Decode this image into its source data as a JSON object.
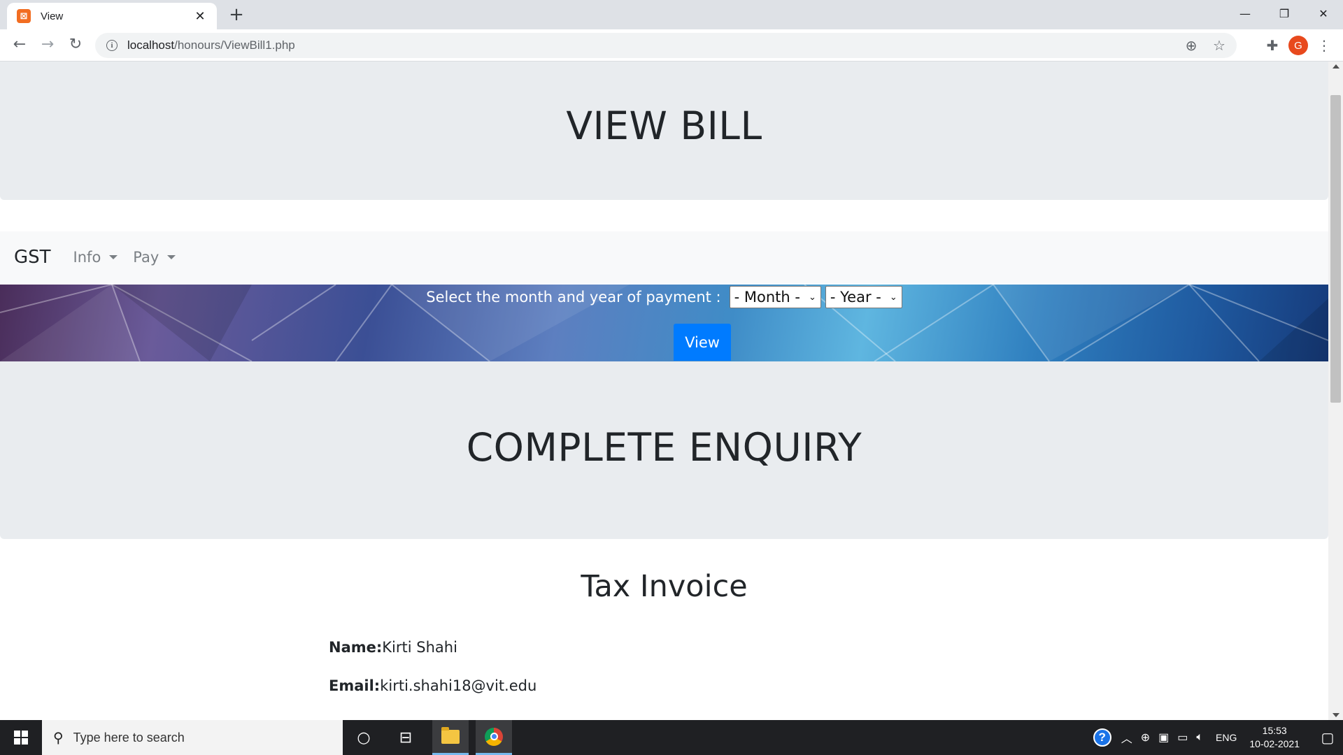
{
  "browser": {
    "tab_title": "View",
    "url_host": "localhost",
    "url_path": "/honours/ViewBill1.php",
    "profile_initial": "G",
    "icons": [
      "back-icon",
      "forward-icon",
      "reload-icon",
      "info-icon",
      "zoom-icon",
      "star-icon",
      "extensions-icon",
      "menu-icon"
    ]
  },
  "page": {
    "header_title": "VIEW BILL",
    "navbar": {
      "brand": "GST",
      "items": [
        {
          "label": "Info"
        },
        {
          "label": "Pay"
        }
      ]
    },
    "filter": {
      "label": "Select the month and year of payment :",
      "month_selected": "- Month -",
      "year_selected": "- Year -",
      "button_label": "View"
    },
    "section_title": "COMPLETE ENQUIRY",
    "invoice": {
      "title": "Tax Invoice",
      "name_label": "Name:",
      "name_value": "Kirti Shahi",
      "email_label": "Email:",
      "email_value": "kirti.shahi18@vit.edu"
    }
  },
  "taskbar": {
    "search_placeholder": "Type here to search",
    "language": "ENG",
    "time": "15:53",
    "date": "10-02-2021"
  },
  "colors": {
    "jumbotron_bg": "#e9ecef",
    "navbar_bg": "#f8f9fa",
    "primary_button": "#007bff",
    "taskbar_bg": "#1f2023"
  }
}
